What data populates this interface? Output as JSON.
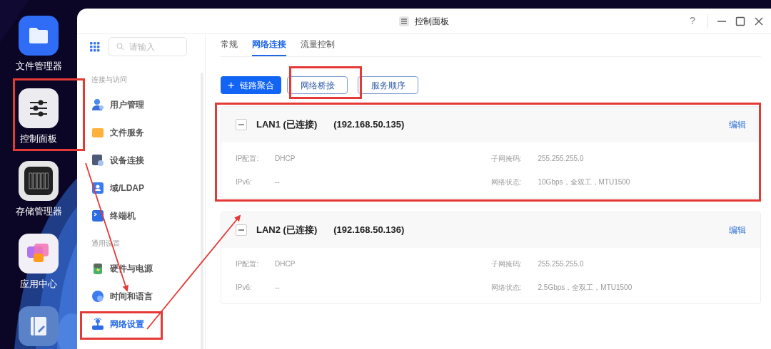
{
  "desktop": {
    "apps": [
      {
        "label": "文件管理器"
      },
      {
        "label": "控制面板"
      },
      {
        "label": "存储管理器"
      },
      {
        "label": "应用中心"
      }
    ]
  },
  "window": {
    "title": "控制面板",
    "help": "?"
  },
  "sidebar": {
    "search": {
      "placeholder": "请输入"
    },
    "sections": [
      {
        "title": "连接与访问",
        "items": [
          {
            "label": "用户管理",
            "selected": false
          },
          {
            "label": "文件服务",
            "selected": false
          },
          {
            "label": "设备连接",
            "selected": false
          },
          {
            "label": "域/LDAP",
            "selected": false
          },
          {
            "label": "终端机",
            "selected": false
          }
        ]
      },
      {
        "title": "通用设置",
        "items": [
          {
            "label": "硬件与电源",
            "selected": false
          },
          {
            "label": "时间和语言",
            "selected": false
          },
          {
            "label": "网络设置",
            "selected": true
          }
        ]
      }
    ]
  },
  "tabs": [
    {
      "label": "常规",
      "selected": false
    },
    {
      "label": "网络连接",
      "selected": true
    },
    {
      "label": "流量控制",
      "selected": false
    }
  ],
  "buttons": [
    {
      "kind": "primary",
      "icon": "+",
      "label": "链路聚合"
    },
    {
      "kind": "secondary",
      "label": "网络桥接"
    },
    {
      "kind": "secondary",
      "label": "服务顺序"
    }
  ],
  "interfaces": [
    {
      "name": "LAN1 (已连接)",
      "ip": "(192.168.50.135)",
      "expanded": true,
      "edit": "编辑",
      "fields": [
        {
          "label": "IP配置:",
          "value": "DHCP"
        },
        {
          "label": "子网掩码:",
          "value": "255.255.255.0"
        },
        {
          "label": "IPv6:",
          "value": "--"
        },
        {
          "label": "网络状态:",
          "value": "10Gbps，全双工，MTU1500"
        }
      ]
    },
    {
      "name": "LAN2 (已连接)",
      "ip": "(192.168.50.136)",
      "expanded": true,
      "edit": "编辑",
      "fields": [
        {
          "label": "IP配置:",
          "value": "DHCP"
        },
        {
          "label": "子网掩码:",
          "value": "255.255.255.0"
        },
        {
          "label": "IPv6:",
          "value": "--"
        },
        {
          "label": "网络状态:",
          "value": "2.5Gbps，全双工，MTU1500"
        }
      ]
    }
  ]
}
